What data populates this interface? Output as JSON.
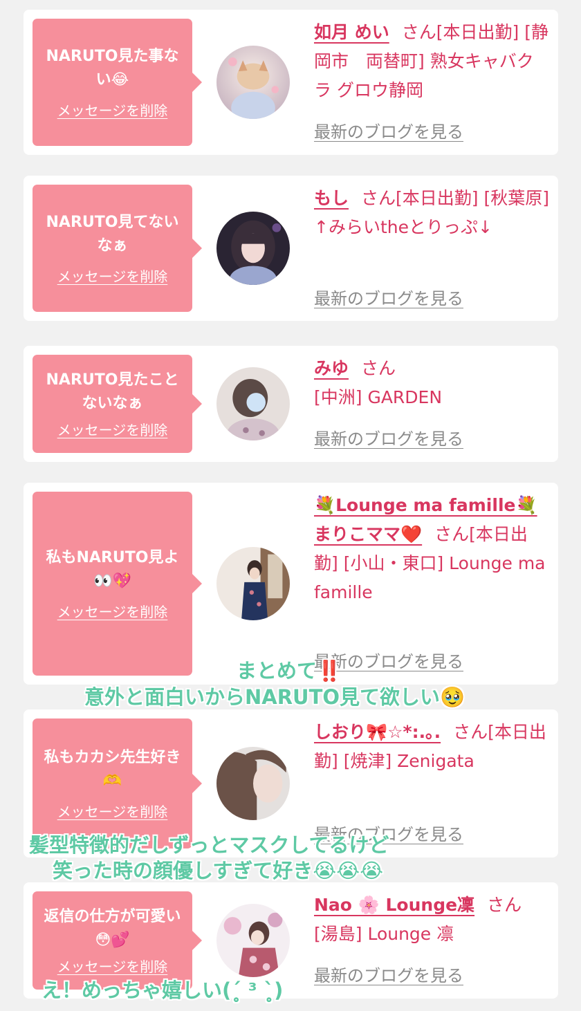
{
  "items": [
    {
      "message": "NARUTO見た事ない😂",
      "delete_label": "メッセージを削除",
      "name": "如月 めい",
      "honorific": "さん",
      "details": "[本日出勤] [静岡市　両替町] 熟女キャバクラ グロウ静岡",
      "blog_label": "最新のブログを見る"
    },
    {
      "message": "NARUTO見てないなぁ",
      "delete_label": "メッセージを削除",
      "name": "もし",
      "honorific": "さん",
      "details": "[本日出勤] [秋葉原] ↑みらいtheとりっぷ↓",
      "blog_label": "最新のブログを見る"
    },
    {
      "message": "NARUTO見たことないなぁ",
      "delete_label": "メッセージを削除",
      "name": "みゆ",
      "honorific": "さん",
      "details": "[中洲] GARDEN",
      "blog_label": "最新のブログを見る"
    },
    {
      "message": "私もNARUTO見よ👀💖",
      "delete_label": "メッセージを削除",
      "name": "💐Lounge ma famille💐まりこママ❤️",
      "honorific": "さん",
      "details": "[本日出勤] [小山・東口] Lounge ma famille",
      "blog_label": "最新のブログを見る"
    },
    {
      "message": "私もカカシ先生好き🫶",
      "delete_label": "メッセージを削除",
      "name": "しおり🎀☆*:.｡.",
      "honorific": "さん",
      "details": "[本日出勤] [焼津] Zenigata",
      "blog_label": "最新のブログを見る"
    },
    {
      "message": "返信の仕方が可愛い😳💕",
      "delete_label": "メッセージを削除",
      "name": "Nao 🌸 Lounge凜",
      "honorific": "さん",
      "details": "[湯島] Lounge 凛",
      "blog_label": "最新のブログを見る"
    }
  ],
  "captions": {
    "c1_line1": "まとめて‼️",
    "c1_line2": "意外と面白いからNARUTO見て欲しい🥹",
    "c2_line1": "髪型特徴的だしずっとマスクしてるけど",
    "c2_line2": "笑った時の顔優しすぎて好き😭😭😭",
    "c3": "え！めっちゃ嬉しい(ˊ̥̥̥̥̥ ³ ˋ̥̥̥̥̥)"
  },
  "colors": {
    "bubble": "#f68f9b",
    "name": "#d8365f",
    "blog_link": "#8a8a8a",
    "caption": "#5ec9a4",
    "background": "#f1f1f1"
  }
}
